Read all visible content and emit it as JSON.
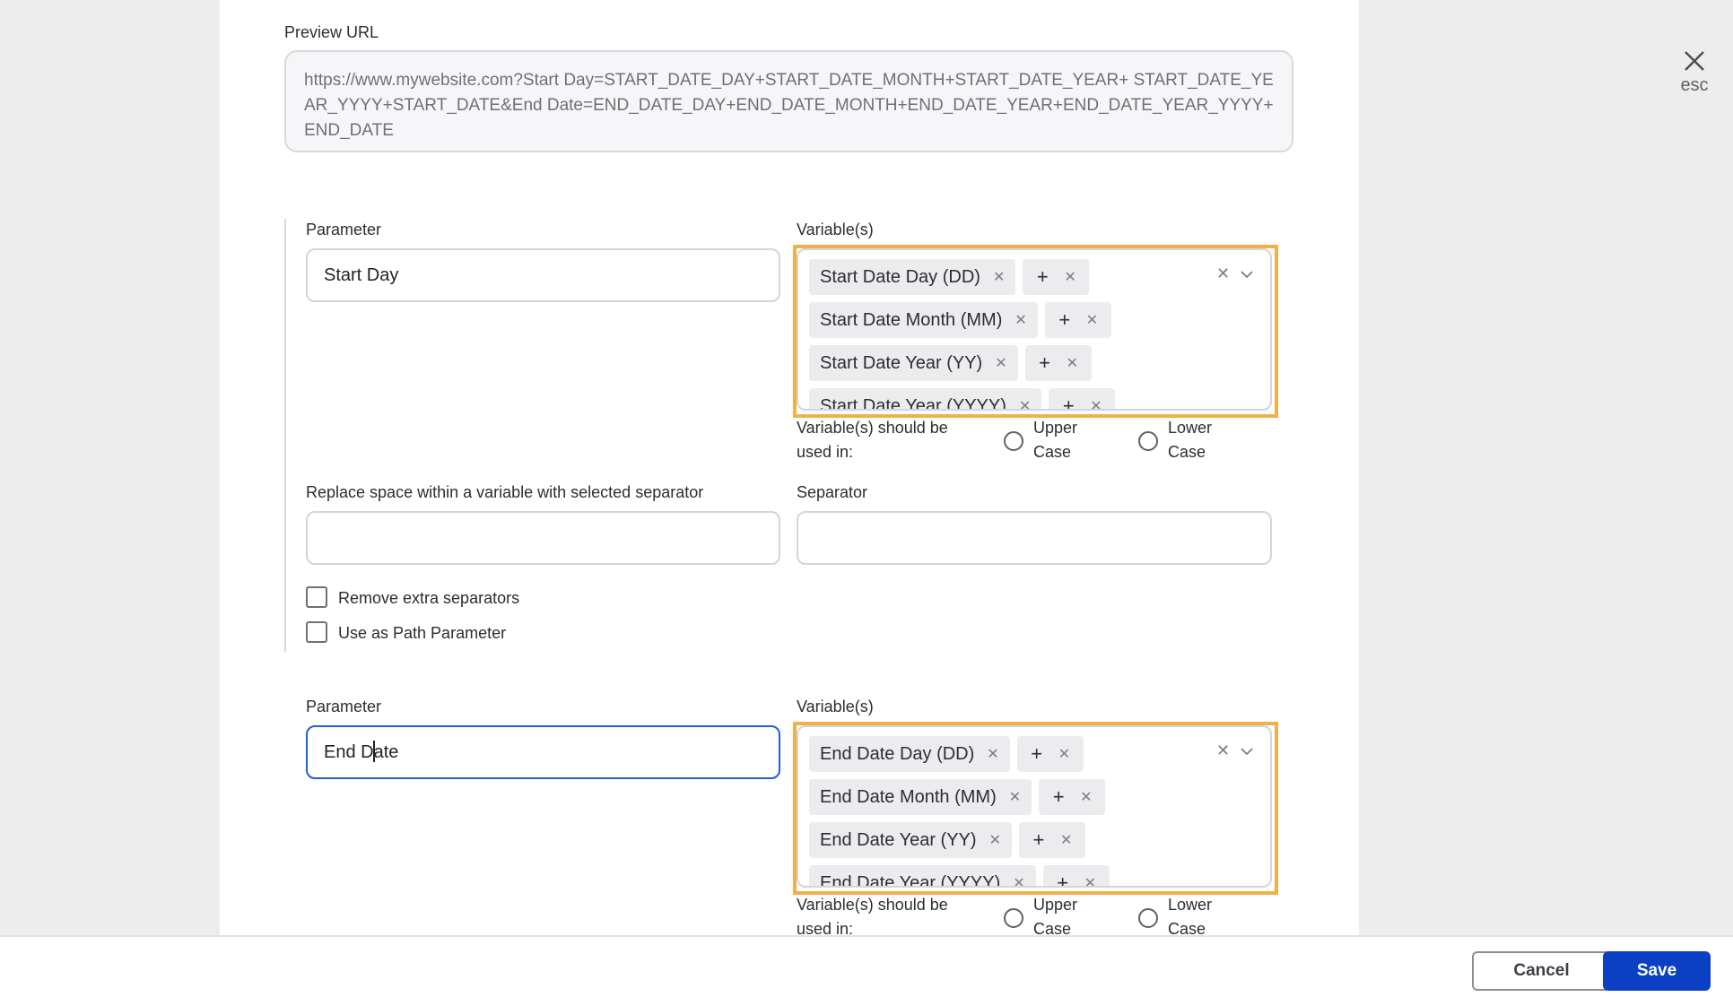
{
  "close": {
    "label": "esc"
  },
  "preview": {
    "label": "Preview URL",
    "url": "https://www.mywebsite.com?Start Day=START_DATE_DAY+START_DATE_MONTH+START_DATE_YEAR+ START_DATE_YEAR_YYYY+START_DATE&End Date=END_DATE_DAY+END_DATE_MONTH+END_DATE_YEAR+END_DATE_YEAR_YYYY+END_DATE"
  },
  "group1": {
    "parameter_label": "Parameter",
    "parameter_value": "Start Day",
    "variables_label": "Variable(s)",
    "chips": [
      "Start Date Day (DD)",
      "Start Date Month (MM)",
      "Start Date Year (YY)",
      "Start Date Year (YYYY)"
    ],
    "plus": "+",
    "case_label": "Variable(s) should be used in:",
    "upper": "Upper Case",
    "lower": "Lower Case",
    "replace_label": "Replace space within a variable with selected separator",
    "separator_label": "Separator",
    "remove_extra": "Remove extra separators",
    "path_param": "Use as Path Parameter"
  },
  "group2": {
    "parameter_label": "Parameter",
    "parameter_value_a": "End D",
    "parameter_value_b": "ate",
    "variables_label": "Variable(s)",
    "chips": [
      "End Date Day (DD)",
      "End Date Month (MM)",
      "End Date Year (YY)",
      "End Date Year (YYYY)"
    ],
    "plus": "+",
    "case_label": "Variable(s) should be used in:",
    "upper": "Upper Case",
    "lower": "Lower Case"
  },
  "footer": {
    "cancel": "Cancel",
    "save": "Save"
  }
}
